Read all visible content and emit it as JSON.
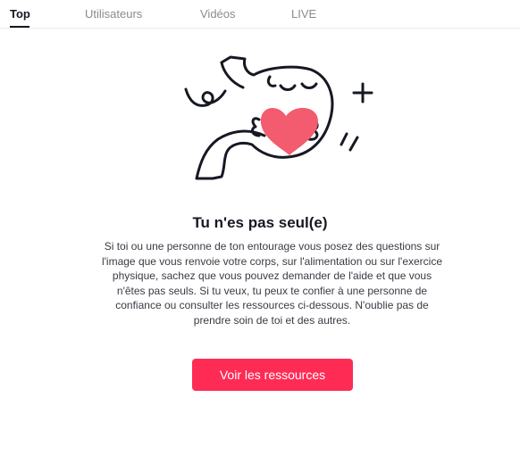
{
  "tabs": [
    {
      "label": "Top",
      "active": true
    },
    {
      "label": "Utilisateurs",
      "active": false
    },
    {
      "label": "Vidéos",
      "active": false
    },
    {
      "label": "LIVE",
      "active": false
    }
  ],
  "support": {
    "illustration_icon": "stomach-with-heart-icon",
    "title": "Tu n'es pas seul(e)",
    "message": "Si toi ou une personne de ton entourage vous posez des questions sur l'image que vous renvoie votre corps, sur l'alimentation ou sur l'exercice physique, sachez que vous pouvez demander de l'aide et que vous n'êtes pas seuls. Si tu veux, tu peux te confier à une personne de confiance ou consulter les ressources ci-dessous. N'oublie pas de prendre soin de toi et des autres.",
    "button_label": "Voir les ressources"
  },
  "colors": {
    "accent": "#fe2c55",
    "heart": "#f25c6e",
    "text_primary": "#161823",
    "text_secondary": "#8a8b91"
  }
}
